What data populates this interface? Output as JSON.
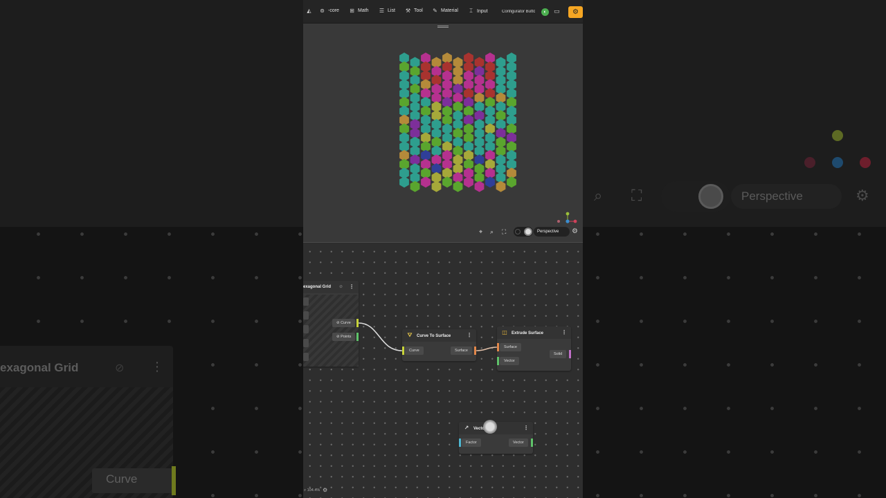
{
  "toolbar": {
    "items": [
      {
        "label": "-core",
        "icon": "core-icon"
      },
      {
        "label": "Math",
        "icon": "math-icon"
      },
      {
        "label": "List",
        "icon": "list-icon"
      },
      {
        "label": "Tool",
        "icon": "tool-icon"
      },
      {
        "label": "Material",
        "icon": "material-icon"
      },
      {
        "label": "Input",
        "icon": "input-icon"
      }
    ],
    "configurator": "Configurator Butto",
    "accent_orange": "#f5a623",
    "accent_green": "#4caf50"
  },
  "viewport": {
    "camera_mode": "Perspective",
    "hex_colors": [
      "#b48a3a",
      "#7d2f9a",
      "#b5318f",
      "#a8332f",
      "#2e9e8e",
      "#5aa52e",
      "#a6a83a",
      "#2f3f98",
      "#3a6fa0"
    ],
    "axis_colors": {
      "x": "#d0415a",
      "y": "#9bbf3a",
      "z": "#3a8fd0"
    }
  },
  "editor": {
    "nodes": {
      "hex_grid": {
        "title": "exagonal Grid",
        "outputs": [
          "Curve",
          "Points"
        ]
      },
      "curve_to_surface": {
        "title": "Curve To Surface",
        "input": "Curve",
        "output": "Surface"
      },
      "extrude_surface": {
        "title": "Extrude Surface",
        "inputs": [
          "Surface",
          "Vector"
        ],
        "output": "Solid"
      },
      "vector": {
        "title": "Vector",
        "input": "Factor",
        "output": "Vector"
      }
    },
    "port_colors": {
      "curve": "#c8d43a",
      "points": "#5fc36a",
      "surface": "#e2874a",
      "solid": "#c070c8",
      "vector": "#5fc36a",
      "factor": "#4fb6d0"
    },
    "zoom": "104.4%"
  },
  "background": {
    "ghost_node_title": "exagonal Grid",
    "ghost_curve_label": "Curve",
    "ghost_perspective": "Perspective"
  }
}
